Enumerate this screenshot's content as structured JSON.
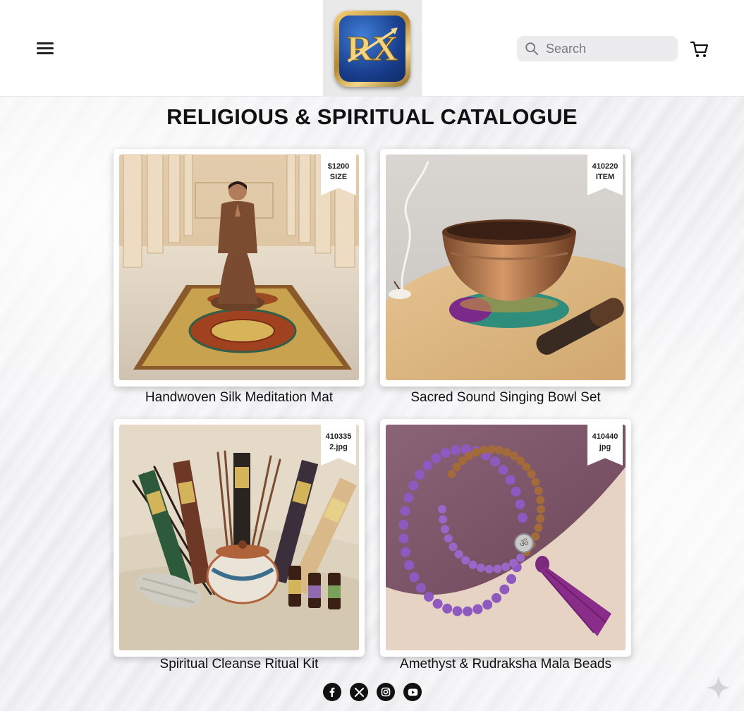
{
  "header": {
    "menu_icon": "hamburger-menu-icon",
    "logo_text": "RX",
    "search": {
      "placeholder": "Search",
      "icon": "search-icon"
    },
    "cart_icon": "shopping-cart-icon"
  },
  "page": {
    "title": "RELIGIOUS & SPIRITUAL CATALOGUE"
  },
  "products": [
    {
      "name": "Handwoven Silk Meditation Mat",
      "tag_line1": "$1200",
      "tag_line2": "SIZE"
    },
    {
      "name": "Sacred Sound Singing Bowl Set",
      "tag_line1": "410220",
      "tag_line2": "ITEM"
    },
    {
      "name": "Spiritual Cleanse Ritual Kit",
      "tag_line1": "410335",
      "tag_line2": "2.jpg"
    },
    {
      "name": "Amethyst & Rudraksha Mala Beads",
      "tag_line1": "410440",
      "tag_line2": "jpg"
    }
  ],
  "footer": {
    "socials": [
      "facebook-icon",
      "x-icon",
      "instagram-icon",
      "youtube-icon"
    ]
  },
  "colors": {
    "accent_gold": "#c9a24a",
    "logo_blue": "#1a3f8e",
    "text": "#111111"
  }
}
